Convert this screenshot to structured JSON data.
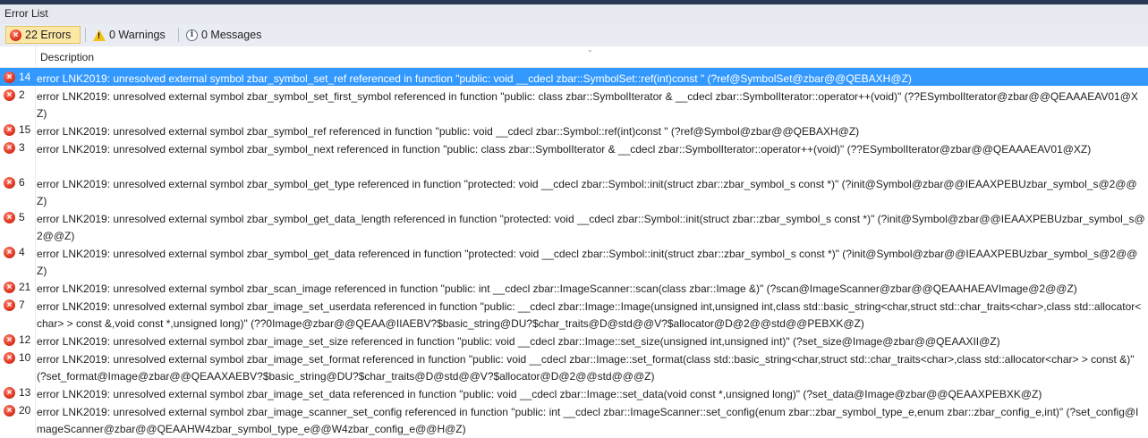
{
  "window": {
    "title": "Error List"
  },
  "toolbar": {
    "errors_label": "22 Errors",
    "warnings_label": "0 Warnings",
    "messages_label": "0 Messages"
  },
  "table": {
    "columns": [
      "",
      "Description"
    ],
    "rows": [
      {
        "num": "14",
        "selected": true,
        "text": "error LNK2019: unresolved external symbol zbar_symbol_set_ref referenced in function \"public: void __cdecl zbar::SymbolSet::ref(int)const \" (?ref@SymbolSet@zbar@@QEBAXH@Z)"
      },
      {
        "num": "2",
        "text": "error LNK2019: unresolved external symbol zbar_symbol_set_first_symbol referenced in function \"public: class zbar::SymbolIterator & __cdecl zbar::SymbolIterator::operator++(void)\" (??ESymbolIterator@zbar@@QEAAAEAV01@XZ)"
      },
      {
        "num": "15",
        "text": "error LNK2019: unresolved external symbol zbar_symbol_ref referenced in function \"public: void __cdecl zbar::Symbol::ref(int)const \" (?ref@Symbol@zbar@@QEBAXH@Z)"
      },
      {
        "num": "3",
        "text": "error LNK2019: unresolved external symbol zbar_symbol_next referenced in function \"public: class zbar::SymbolIterator & __cdecl zbar::SymbolIterator::operator++(void)\" (??ESymbolIterator@zbar@@QEAAAEAV01@XZ)"
      },
      {
        "num": "6",
        "text": "error LNK2019: unresolved external symbol zbar_symbol_get_type referenced in function \"protected: void __cdecl zbar::Symbol::init(struct zbar::zbar_symbol_s const *)\" (?init@Symbol@zbar@@IEAAXPEBUzbar_symbol_s@2@@Z)"
      },
      {
        "num": "5",
        "text": "error LNK2019: unresolved external symbol zbar_symbol_get_data_length referenced in function \"protected: void __cdecl zbar::Symbol::init(struct zbar::zbar_symbol_s const *)\" (?init@Symbol@zbar@@IEAAXPEBUzbar_symbol_s@2@@Z)"
      },
      {
        "num": "4",
        "text": "error LNK2019: unresolved external symbol zbar_symbol_get_data referenced in function \"protected: void __cdecl zbar::Symbol::init(struct zbar::zbar_symbol_s const *)\" (?init@Symbol@zbar@@IEAAXPEBUzbar_symbol_s@2@@Z)"
      },
      {
        "num": "21",
        "text": "error LNK2019: unresolved external symbol zbar_scan_image referenced in function \"public: int __cdecl zbar::ImageScanner::scan(class zbar::Image &)\" (?scan@ImageScanner@zbar@@QEAAHAEAVImage@2@@Z)"
      },
      {
        "num": "7",
        "text": "error LNK2019: unresolved external symbol zbar_image_set_userdata referenced in function \"public: __cdecl zbar::Image::Image(unsigned int,unsigned int,class std::basic_string<char,struct std::char_traits<char>,class std::allocator<char> > const &,void const *,unsigned long)\" (??0Image@zbar@@QEAA@IIAEBV?$basic_string@DU?$char_traits@D@std@@V?$allocator@D@2@@std@@PEBXK@Z)"
      },
      {
        "num": "12",
        "text": "error LNK2019: unresolved external symbol zbar_image_set_size referenced in function \"public: void __cdecl zbar::Image::set_size(unsigned int,unsigned int)\" (?set_size@Image@zbar@@QEAAXII@Z)"
      },
      {
        "num": "10",
        "text": "error LNK2019: unresolved external symbol zbar_image_set_format referenced in function \"public: void __cdecl zbar::Image::set_format(class std::basic_string<char,struct std::char_traits<char>,class std::allocator<char> > const &)\" (?set_format@Image@zbar@@QEAAXAEBV?$basic_string@DU?$char_traits@D@std@@V?$allocator@D@2@@std@@@Z)"
      },
      {
        "num": "13",
        "text": "error LNK2019: unresolved external symbol zbar_image_set_data referenced in function \"public: void __cdecl zbar::Image::set_data(void const *,unsigned long)\" (?set_data@Image@zbar@@QEAAXPEBXK@Z)"
      },
      {
        "num": "20",
        "text": "error LNK2019: unresolved external symbol zbar_image_scanner_set_config referenced in function \"public: int __cdecl zbar::ImageScanner::set_config(enum zbar::zbar_symbol_type_e,enum zbar::zbar_config_e,int)\" (?set_config@ImageScanner@zbar@@QEAAHW4zbar_symbol_type_e@@W4zbar_config_e@@H@Z)"
      }
    ]
  },
  "colors": {
    "selection": "#3399ff",
    "error_icon": "#e23b24",
    "warning_icon": "#f2c21b"
  },
  "icons": {
    "error": "error-circle-icon",
    "warning": "warning-triangle-icon",
    "info": "info-circle-icon"
  }
}
